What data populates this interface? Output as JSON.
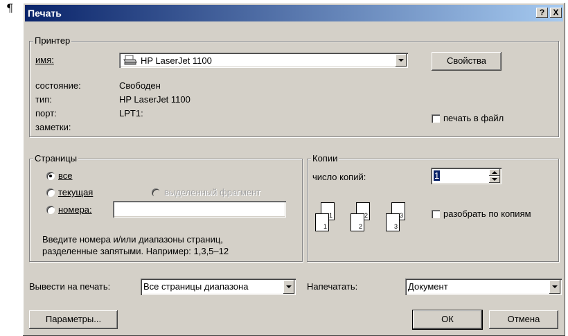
{
  "pilcrow": "¶",
  "window": {
    "title": "Печать",
    "help": "?",
    "close": "X"
  },
  "printer": {
    "group_label": "Принтер",
    "name_label": "имя:",
    "name_value": "HP LaserJet 1100",
    "properties_button": "Свойства",
    "status_label": "состояние:",
    "status_value": "Свободен",
    "type_label": "тип:",
    "type_value": "HP LaserJet 1100",
    "port_label": "порт:",
    "port_value": "LPT1:",
    "notes_label": "заметки:",
    "print_to_file": "печать в файл"
  },
  "pages": {
    "group_label": "Страницы",
    "all": "все",
    "current": "текущая",
    "selection": "выделенный фрагмент",
    "numbers": "номера:",
    "numbers_value": "",
    "hint_line1": "Введите номера и/или диапазоны страниц,",
    "hint_line2": "разделенные запятыми. Например: 1,3,5–12",
    "selected": "all"
  },
  "copies": {
    "group_label": "Копии",
    "count_label": "число копий:",
    "count_value": "1",
    "collate": "разобрать по копиям",
    "stack_labels": [
      "1",
      "2",
      "3"
    ]
  },
  "output": {
    "print_label": "Вывести на печать:",
    "print_value": "Все страницы диапазона",
    "what_label": "Напечатать:",
    "what_value": "Документ"
  },
  "buttons": {
    "options": "Параметры...",
    "ok": "ОК",
    "cancel": "Отмена"
  }
}
